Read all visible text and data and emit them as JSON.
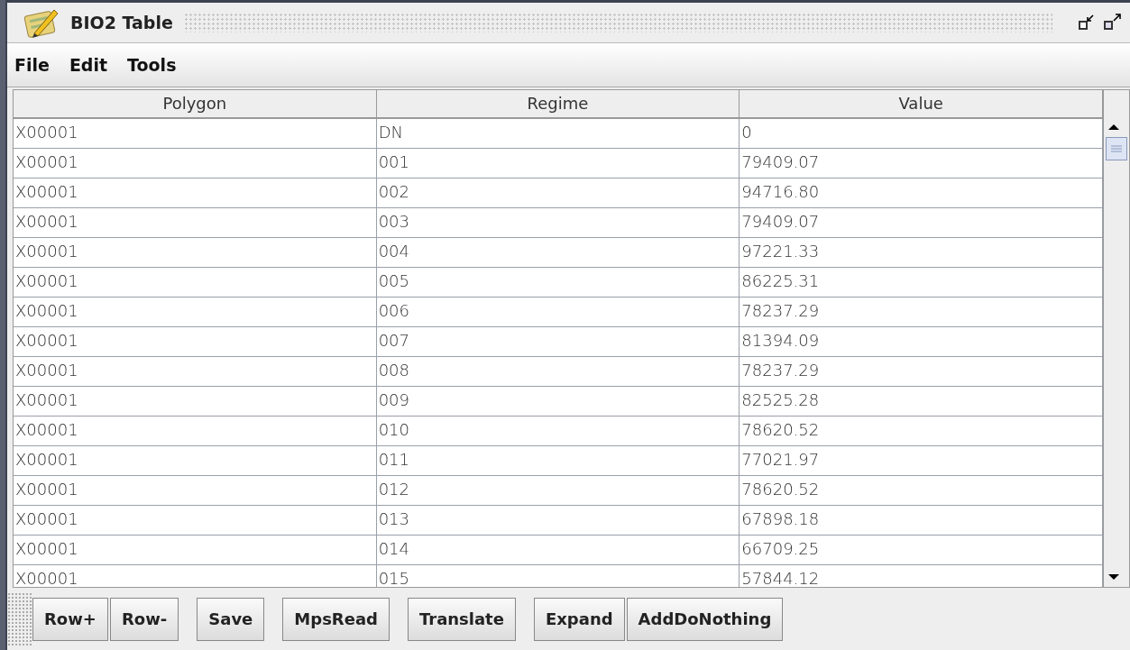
{
  "window": {
    "title": "BIO2 Table"
  },
  "menu": [
    "File",
    "Edit",
    "Tools"
  ],
  "table": {
    "columns": [
      "Polygon",
      "Regime",
      "Value"
    ],
    "rows": [
      [
        "X00001",
        "DN",
        "0"
      ],
      [
        "X00001",
        "001",
        "79409.07"
      ],
      [
        "X00001",
        "002",
        "94716.80"
      ],
      [
        "X00001",
        "003",
        "79409.07"
      ],
      [
        "X00001",
        "004",
        "97221.33"
      ],
      [
        "X00001",
        "005",
        "86225.31"
      ],
      [
        "X00001",
        "006",
        "78237.29"
      ],
      [
        "X00001",
        "007",
        "81394.09"
      ],
      [
        "X00001",
        "008",
        "78237.29"
      ],
      [
        "X00001",
        "009",
        "82525.28"
      ],
      [
        "X00001",
        "010",
        "78620.52"
      ],
      [
        "X00001",
        "011",
        "77021.97"
      ],
      [
        "X00001",
        "012",
        "78620.52"
      ],
      [
        "X00001",
        "013",
        "67898.18"
      ],
      [
        "X00001",
        "014",
        "66709.25"
      ],
      [
        "X00001",
        "015",
        "57844.12"
      ]
    ]
  },
  "button_groups": [
    [
      "Row+",
      "Row-"
    ],
    [
      "Save"
    ],
    [
      "MpsRead"
    ],
    [
      "Translate"
    ],
    [
      "Expand",
      "AddDoNothing"
    ]
  ]
}
